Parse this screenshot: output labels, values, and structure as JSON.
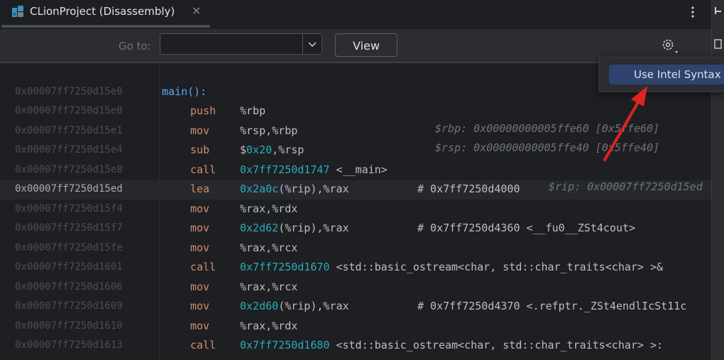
{
  "tab": {
    "title": "CLionProject (Disassembly)",
    "close": "×"
  },
  "toolbar": {
    "goto_label": "Go to:",
    "goto_value": "",
    "view_label": "View"
  },
  "menu": {
    "item": "Use Intel Syntax"
  },
  "colors": {
    "label": "#56a8f5",
    "mnemonic": "#cf8e6d",
    "hex": "#2aacb8",
    "selection": "#2e436e",
    "arrow": "#e0231f"
  },
  "rows": [
    {
      "addr": "0x00007ff7250d15e0",
      "label": "main():"
    },
    {
      "addr": "0x00007ff7250d15e0",
      "mnem": "push",
      "op": "%rbp"
    },
    {
      "addr": "0x00007ff7250d15e1",
      "mnem": "mov",
      "op": "%rsp,%rbp",
      "hint": "$rbp: 0x00000000005ffe60 [0x5ffe60]"
    },
    {
      "addr": "0x00007ff7250d15e4",
      "mnem": "sub",
      "op_pre": "$",
      "op_hex": "0x20",
      "op_post": ",%rsp",
      "hint": "$rsp: 0x00000000005ffe40 [0x5ffe40]"
    },
    {
      "addr": "0x00007ff7250d15e8",
      "mnem": "call",
      "op_hex": "0x7ff7250d1747",
      "op_post": " <__main>"
    },
    {
      "addr": "0x00007ff7250d15ed",
      "mnem": "lea",
      "op_hex": "0x2a0c",
      "op_post": "(%rip),%rax",
      "comment": "# 0x7ff7250d4000",
      "hint": "$rip: 0x00007ff7250d15ed",
      "current": true
    },
    {
      "addr": "0x00007ff7250d15f4",
      "mnem": "mov",
      "op": "%rax,%rdx"
    },
    {
      "addr": "0x00007ff7250d15f7",
      "mnem": "mov",
      "op_hex": "0x2d62",
      "op_post": "(%rip),%rax",
      "comment": "# 0x7ff7250d4360 <__fu0__ZSt4cout>"
    },
    {
      "addr": "0x00007ff7250d15fe",
      "mnem": "mov",
      "op": "%rax,%rcx"
    },
    {
      "addr": "0x00007ff7250d1601",
      "mnem": "call",
      "op_hex": "0x7ff7250d1670",
      "op_post": " <std::basic_ostream<char, std::char_traits<char> >&"
    },
    {
      "addr": "0x00007ff7250d1606",
      "mnem": "mov",
      "op": "%rax,%rcx"
    },
    {
      "addr": "0x00007ff7250d1609",
      "mnem": "mov",
      "op_hex": "0x2d60",
      "op_post": "(%rip),%rax",
      "comment": "# 0x7ff7250d4370 <.refptr._ZSt4endlIcSt11c"
    },
    {
      "addr": "0x00007ff7250d1610",
      "mnem": "mov",
      "op": "%rax,%rdx"
    },
    {
      "addr": "0x00007ff7250d1613",
      "mnem": "call",
      "op_hex": "0x7ff7250d1680",
      "op_post": " <std::basic_ostream<char, std::char_traits<char> >:"
    }
  ]
}
